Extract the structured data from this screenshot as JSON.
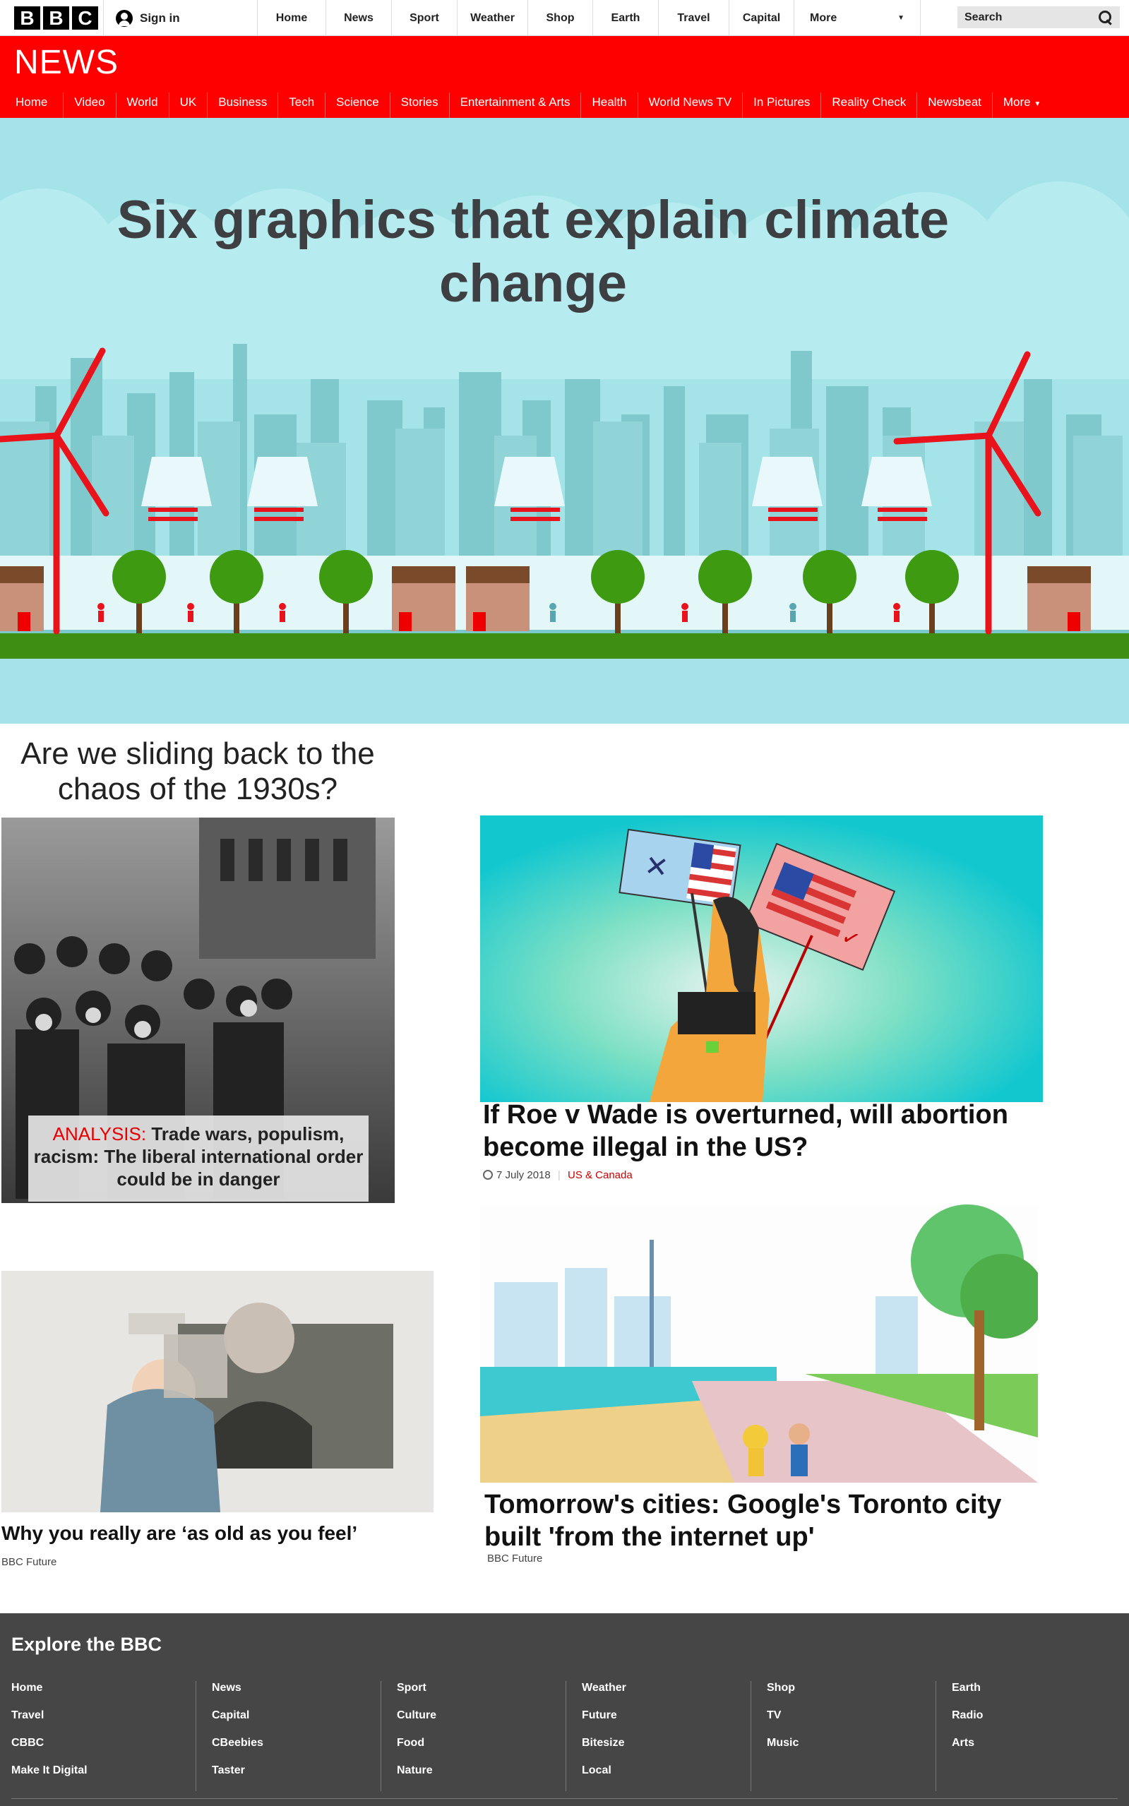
{
  "global_bar": {
    "logo_letters": [
      "B",
      "B",
      "C"
    ],
    "signin_label": "Sign in",
    "nav": [
      "Home",
      "News",
      "Sport",
      "Weather",
      "Shop",
      "Earth",
      "Travel",
      "Capital"
    ],
    "more_label": "More",
    "search_label": "Search"
  },
  "news_bar": {
    "logo": "NEWS",
    "nav": [
      "Home",
      "Video",
      "World",
      "UK",
      "Business",
      "Tech",
      "Science",
      "Stories",
      "Entertainment & Arts",
      "Health",
      "World News TV",
      "In Pictures",
      "Reality Check",
      "Newsbeat"
    ],
    "more_label": "More",
    "active": "Home"
  },
  "hero": {
    "headline": "Six graphics that explain climate change"
  },
  "articles": {
    "thirties": {
      "title": "Are we sliding back to the chaos of the 1930s?",
      "caption_tag": "ANALYSIS:",
      "caption_text": "Trade wars, populism, racism: The liberal international order could be in danger"
    },
    "roe": {
      "title": "If Roe v Wade is overturned, will abortion become illegal in the US?",
      "date": "7 July 2018",
      "section": "US & Canada"
    },
    "old": {
      "title": "Why you really are ‘as old as you feel’",
      "source": "BBC Future"
    },
    "toronto": {
      "title": "Tomorrow's cities: Google's Toronto city built 'from the internet up'",
      "source": "BBC Future"
    }
  },
  "footer": {
    "title": "Explore the BBC",
    "columns": [
      [
        "Home",
        "Travel",
        "CBBC",
        "Make It Digital"
      ],
      [
        "News",
        "Capital",
        "CBeebies",
        "Taster"
      ],
      [
        "Sport",
        "Culture",
        "Food",
        "Nature"
      ],
      [
        "Weather",
        "Future",
        "Bitesize",
        "Local"
      ],
      [
        "Shop",
        "TV",
        "Music"
      ],
      [
        "Earth",
        "Radio",
        "Arts"
      ]
    ]
  },
  "colors": {
    "bbc_red": "#ff0000",
    "hero_bg": "#a4e4e8",
    "footer_bg": "#464646"
  }
}
